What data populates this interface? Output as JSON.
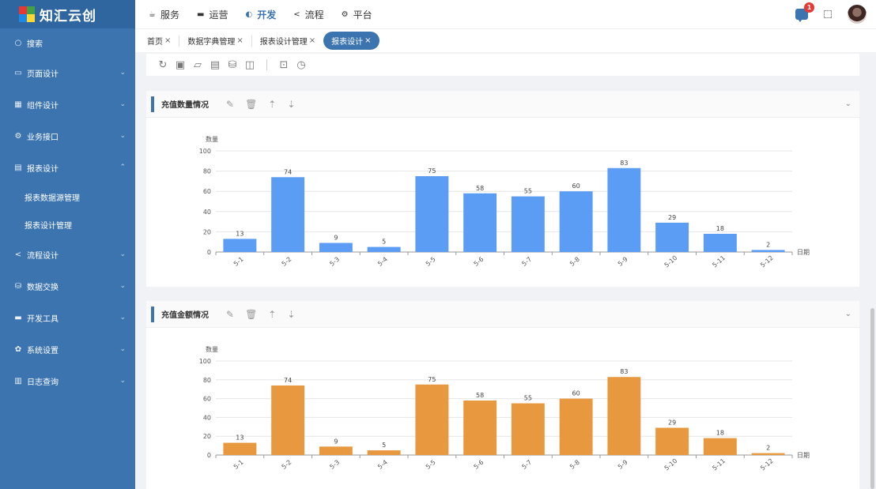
{
  "app": {
    "title": "知汇云创"
  },
  "sidebar": {
    "search_label": "搜索",
    "items": [
      {
        "label": "页面设计",
        "icon": "window-icon",
        "glyph": "▭",
        "expanded": false
      },
      {
        "label": "组件设计",
        "icon": "grid-icon",
        "glyph": "▦",
        "expanded": false
      },
      {
        "label": "业务接口",
        "icon": "gear-icon",
        "glyph": "⚙",
        "expanded": false
      },
      {
        "label": "报表设计",
        "icon": "clipboard-icon",
        "glyph": "▤",
        "expanded": true
      },
      {
        "label": "流程设计",
        "icon": "share-icon",
        "glyph": "<",
        "expanded": false
      },
      {
        "label": "数据交换",
        "icon": "database-icon",
        "glyph": "⛁",
        "expanded": false
      },
      {
        "label": "开发工具",
        "icon": "toolbox-icon",
        "glyph": "▬",
        "expanded": false
      },
      {
        "label": "系统设置",
        "icon": "settings-icon",
        "glyph": "✿",
        "expanded": false
      },
      {
        "label": "日志查询",
        "icon": "log-icon",
        "glyph": "▥",
        "expanded": false
      }
    ],
    "subitems": [
      "报表数据源管理",
      "报表设计管理"
    ]
  },
  "topnav": [
    {
      "label": "服务",
      "icon": "cup-icon",
      "glyph": "☕",
      "active": false
    },
    {
      "label": "运营",
      "icon": "monitor-icon",
      "glyph": "▬",
      "active": false
    },
    {
      "label": "开发",
      "icon": "code-icon",
      "glyph": "◐",
      "active": true
    },
    {
      "label": "流程",
      "icon": "share-icon",
      "glyph": "<",
      "active": false
    },
    {
      "label": "平台",
      "icon": "gear-icon",
      "glyph": "⚙",
      "active": false
    }
  ],
  "notifications": {
    "count": "1"
  },
  "tabs": [
    {
      "label": "首页",
      "active": false
    },
    {
      "label": "数据字典管理",
      "active": false
    },
    {
      "label": "报表设计管理",
      "active": false
    },
    {
      "label": "报表设计",
      "active": true
    }
  ],
  "tab_close": "×",
  "toolbar": [
    "refresh-icon",
    "save-icon",
    "folder-icon",
    "print-icon",
    "database-icon",
    "preview-icon",
    "export-icon",
    "timer-icon"
  ],
  "colors": {
    "sidebar": "#3b74ae",
    "accent": "#3b74ae",
    "bar1": "#5b9cf4",
    "bar2": "#e8993f"
  },
  "panels": [
    {
      "title": "充值数量情况"
    },
    {
      "title": "充值金额情况"
    }
  ],
  "chart_data": [
    {
      "type": "bar",
      "ylabel": "数量",
      "xlabel": "日期",
      "ylim": [
        0,
        100
      ],
      "yticks": [
        0,
        20,
        40,
        60,
        80,
        100
      ],
      "categories": [
        "5-1",
        "5-2",
        "5-3",
        "5-4",
        "5-5",
        "5-6",
        "5-7",
        "5-8",
        "5-9",
        "5-10",
        "5-11",
        "5-12"
      ],
      "values": [
        13,
        74,
        9,
        5,
        75,
        58,
        55,
        60,
        83,
        29,
        18,
        2
      ],
      "color": "#5b9cf4",
      "grid": true
    },
    {
      "type": "bar",
      "ylabel": "数量",
      "xlabel": "日期",
      "ylim": [
        0,
        100
      ],
      "yticks": [
        0,
        20,
        40,
        60,
        80,
        100
      ],
      "categories": [
        "5-1",
        "5-2",
        "5-3",
        "5-4",
        "5-5",
        "5-6",
        "5-7",
        "5-8",
        "5-9",
        "5-10",
        "5-11",
        "5-12"
      ],
      "values": [
        13,
        74,
        9,
        5,
        75,
        58,
        55,
        60,
        83,
        29,
        18,
        2
      ],
      "color": "#e8993f",
      "grid": true
    }
  ]
}
